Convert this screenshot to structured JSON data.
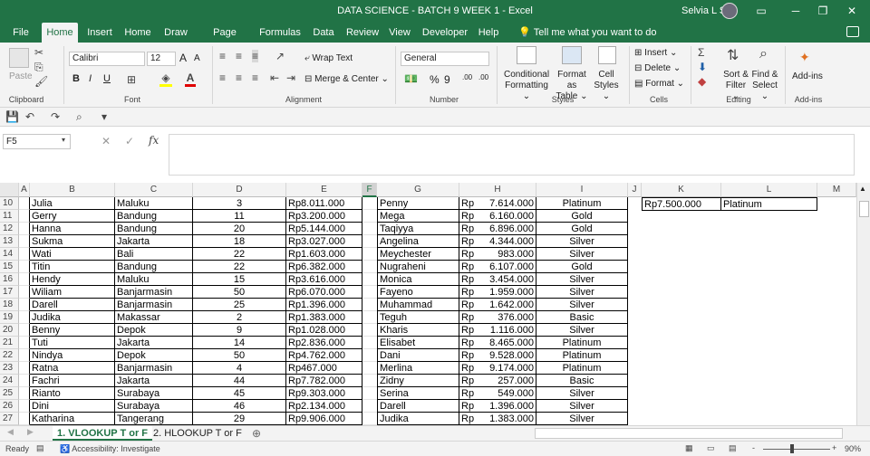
{
  "titlebar": {
    "title": "DATA SCIENCE - BATCH 9 WEEK 1  -  Excel",
    "user": "Selvia L S",
    "ribbon_display_icon": "ribbon-display-icon",
    "minimize": "─",
    "restore": "❐",
    "close": "✕"
  },
  "tabs": [
    "File",
    "Home",
    "Insert",
    "Home",
    "Draw",
    "Page Layout",
    "Formulas",
    "Data",
    "Review",
    "View",
    "Developer",
    "Help"
  ],
  "tellme": "Tell me what you want to do",
  "ribbon": {
    "clipboard": {
      "paste": "Paste",
      "label": "Clipboard"
    },
    "font": {
      "name": "Calibri",
      "size": "12",
      "grow": "A",
      "shrink": "A",
      "bold": "B",
      "italic": "I",
      "underline": "U",
      "label": "Font"
    },
    "alignment": {
      "wrap": "Wrap Text",
      "merge": "Merge & Center",
      "label": "Alignment"
    },
    "number": {
      "format": "General",
      "percent": "%",
      "comma": "9",
      "inc": ".00",
      "dec": ".00",
      "label": "Number"
    },
    "styles": {
      "conditional": "Conditional",
      "conditional2": "Formatting",
      "format_as": "Format as",
      "format_as2": "Table",
      "cell": "Cell",
      "cell2": "Styles",
      "label": "Styles"
    },
    "cells": {
      "insert": "Insert",
      "delete": "Delete",
      "format": "Format",
      "label": "Cells"
    },
    "editing": {
      "sort": "Sort &",
      "sort2": "Filter",
      "find": "Find &",
      "find2": "Select",
      "label": "Editing"
    },
    "addins": {
      "addins": "Add-ins",
      "label": "Add-ins"
    }
  },
  "formula_bar": {
    "name_box": "F5",
    "fx": "fx",
    "cancel": "✕",
    "enter": "✓",
    "formula": ""
  },
  "columns": [
    "A",
    "B",
    "C",
    "D",
    "E",
    "F",
    "G",
    "H",
    "I",
    "J",
    "K",
    "L",
    "M"
  ],
  "rows": [
    {
      "n": "10",
      "b": "Julia",
      "c": "Maluku",
      "d": "3",
      "e": "Rp8.011.000",
      "g": "Penny",
      "h1": "Rp",
      "h2": "7.614.000",
      "i": "Platinum"
    },
    {
      "n": "11",
      "b": "Gerry",
      "c": "Bandung",
      "d": "11",
      "e": "Rp3.200.000",
      "g": "Mega",
      "h1": "Rp",
      "h2": "6.160.000",
      "i": "Gold"
    },
    {
      "n": "12",
      "b": "Hanna",
      "c": "Bandung",
      "d": "20",
      "e": "Rp5.144.000",
      "g": "Taqiyya",
      "h1": "Rp",
      "h2": "6.896.000",
      "i": "Gold"
    },
    {
      "n": "13",
      "b": "Sukma",
      "c": "Jakarta",
      "d": "18",
      "e": "Rp3.027.000",
      "g": "Angelina",
      "h1": "Rp",
      "h2": "4.344.000",
      "i": "Silver"
    },
    {
      "n": "14",
      "b": "Wati",
      "c": "Bali",
      "d": "22",
      "e": "Rp1.603.000",
      "g": "Meychester",
      "h1": "Rp",
      "h2": "983.000",
      "i": "Silver"
    },
    {
      "n": "15",
      "b": "Titin",
      "c": "Bandung",
      "d": "22",
      "e": "Rp6.382.000",
      "g": "Nugraheni",
      "h1": "Rp",
      "h2": "6.107.000",
      "i": "Gold"
    },
    {
      "n": "16",
      "b": "Hendy",
      "c": "Maluku",
      "d": "15",
      "e": "Rp3.616.000",
      "g": "Monica",
      "h1": "Rp",
      "h2": "3.454.000",
      "i": "Silver"
    },
    {
      "n": "17",
      "b": "Wiliam",
      "c": "Banjarmasin",
      "d": "50",
      "e": "Rp6.070.000",
      "g": "Fayeno",
      "h1": "Rp",
      "h2": "1.959.000",
      "i": "Silver"
    },
    {
      "n": "18",
      "b": "Darell",
      "c": "Banjarmasin",
      "d": "25",
      "e": "Rp1.396.000",
      "g": "Muhammad",
      "h1": "Rp",
      "h2": "1.642.000",
      "i": "Silver"
    },
    {
      "n": "19",
      "b": "Judika",
      "c": "Makassar",
      "d": "2",
      "e": "Rp1.383.000",
      "g": "Teguh",
      "h1": "Rp",
      "h2": "376.000",
      "i": "Basic"
    },
    {
      "n": "20",
      "b": "Benny",
      "c": "Depok",
      "d": "9",
      "e": "Rp1.028.000",
      "g": "Kharis",
      "h1": "Rp",
      "h2": "1.116.000",
      "i": "Silver"
    },
    {
      "n": "21",
      "b": "Tuti",
      "c": "Jakarta",
      "d": "14",
      "e": "Rp2.836.000",
      "g": "Elisabet",
      "h1": "Rp",
      "h2": "8.465.000",
      "i": "Platinum"
    },
    {
      "n": "22",
      "b": "Nindya",
      "c": "Depok",
      "d": "50",
      "e": "Rp4.762.000",
      "g": "Dani",
      "h1": "Rp",
      "h2": "9.528.000",
      "i": "Platinum"
    },
    {
      "n": "23",
      "b": "Ratna",
      "c": "Banjarmasin",
      "d": "4",
      "e": "Rp467.000",
      "g": "Merlina",
      "h1": "Rp",
      "h2": "9.174.000",
      "i": "Platinum"
    },
    {
      "n": "24",
      "b": "Fachri",
      "c": "Jakarta",
      "d": "44",
      "e": "Rp7.782.000",
      "g": "Zidny",
      "h1": "Rp",
      "h2": "257.000",
      "i": "Basic"
    },
    {
      "n": "25",
      "b": "Rianto",
      "c": "Surabaya",
      "d": "45",
      "e": "Rp9.303.000",
      "g": "Serina",
      "h1": "Rp",
      "h2": "549.000",
      "i": "Silver"
    },
    {
      "n": "26",
      "b": "Dini",
      "c": "Surabaya",
      "d": "46",
      "e": "Rp2.134.000",
      "g": "Darell",
      "h1": "Rp",
      "h2": "1.396.000",
      "i": "Silver"
    },
    {
      "n": "27",
      "b": "Katharina",
      "c": "Tangerang",
      "d": "29",
      "e": "Rp9.906.000",
      "g": "Judika",
      "h1": "Rp",
      "h2": "1.383.000",
      "i": "Silver"
    }
  ],
  "lookup": {
    "k": "Rp7.500.000",
    "l": "Platinum"
  },
  "sheets": [
    "1. VLOOKUP T or F",
    "2. HLOOKUP T or F"
  ],
  "status": {
    "ready": "Ready",
    "accessibility": "Accessibility: Investigate",
    "zoom": "90%",
    "minus": "-",
    "plus": "+"
  },
  "colors": {
    "accent": "#217346"
  }
}
